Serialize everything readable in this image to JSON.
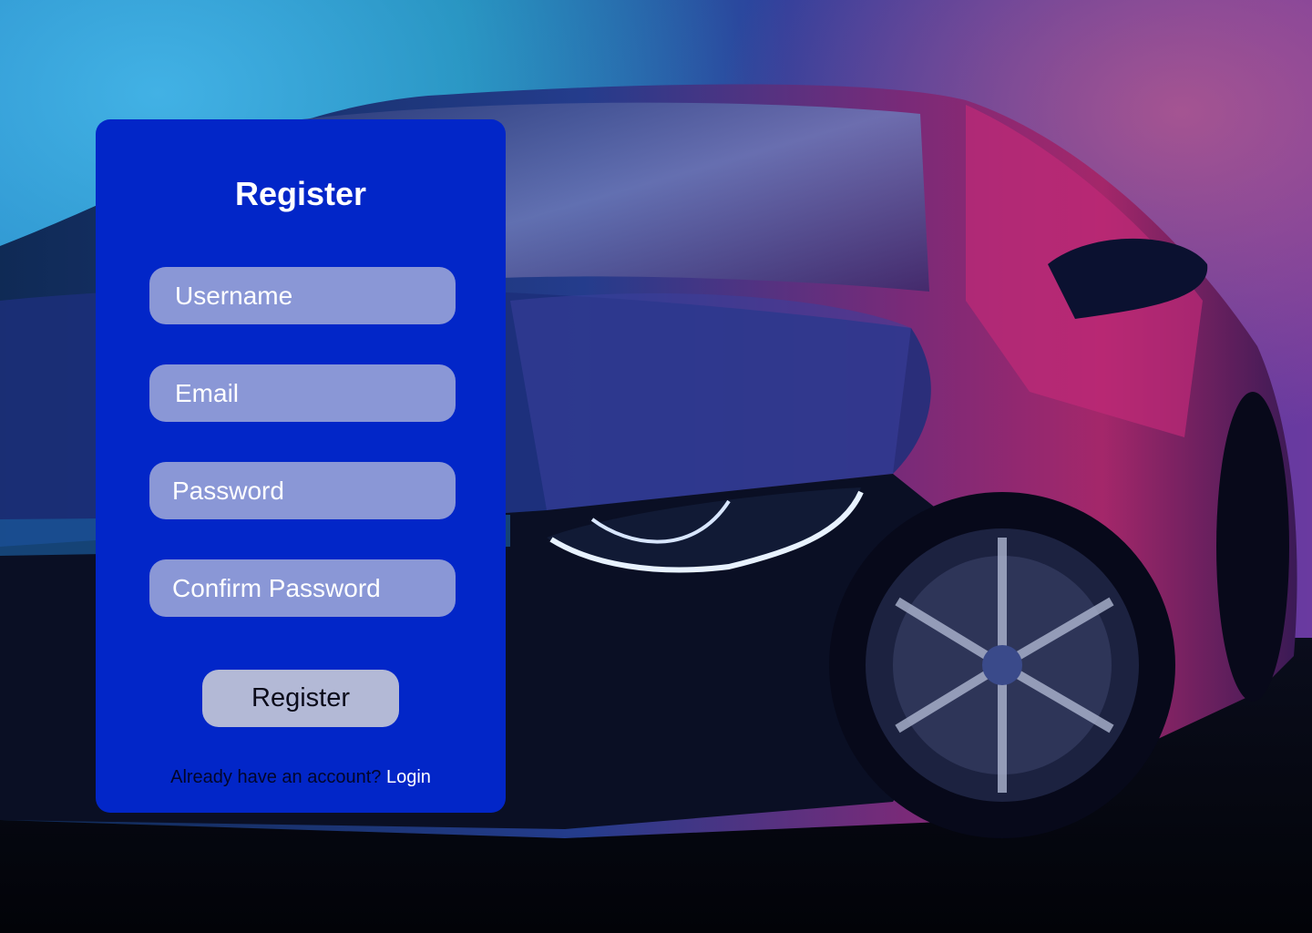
{
  "background": {
    "subject": "car",
    "palette": {
      "sky_blue": "#1a93c8",
      "violet": "#5a3aa6",
      "magenta": "#b3286e",
      "body": "#0d1230",
      "ground": "#05070f"
    }
  },
  "form": {
    "title": "Register",
    "background_color": "#0226c8",
    "fields": {
      "username": {
        "placeholder": "Username",
        "value": ""
      },
      "email": {
        "placeholder": "Email",
        "value": ""
      },
      "password": {
        "placeholder": "Password",
        "value": ""
      },
      "confirm_password": {
        "placeholder": "Confirm Password",
        "value": ""
      }
    },
    "submit_label": "Register",
    "footer": {
      "prompt": "Already have an account?",
      "link_label": "Login"
    }
  }
}
